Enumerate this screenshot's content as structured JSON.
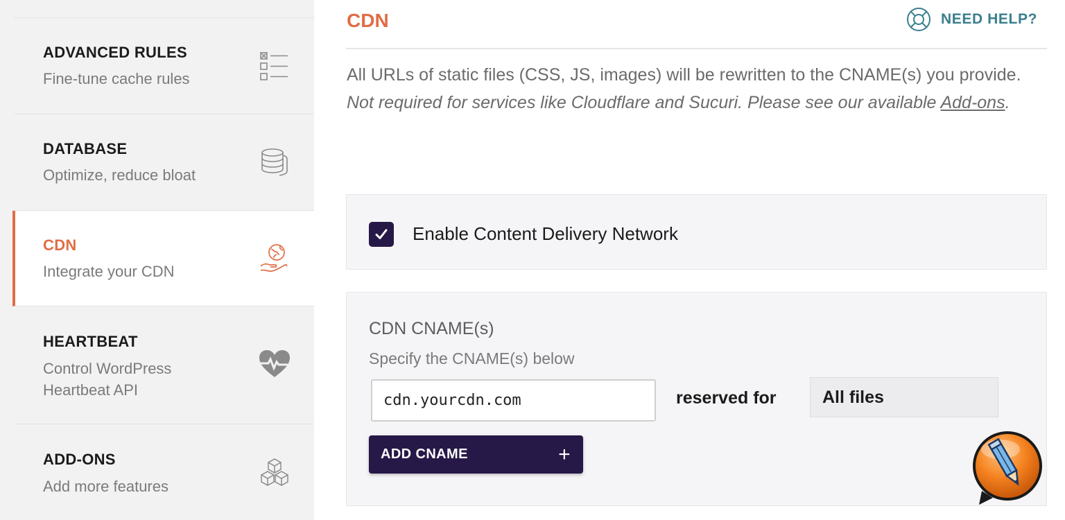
{
  "sidebar": {
    "items": [
      {
        "title": "ADVANCED RULES",
        "subtitle": "Fine-tune cache rules",
        "icon": "rules-list-icon"
      },
      {
        "title": "DATABASE",
        "subtitle": "Optimize, reduce bloat",
        "icon": "database-icon"
      },
      {
        "title": "CDN",
        "subtitle": "Integrate your CDN",
        "icon": "globe-hand-icon",
        "active": true
      },
      {
        "title": "HEARTBEAT",
        "subtitle_line1": "Control WordPress",
        "subtitle_line2": "Heartbeat API",
        "icon": "heartbeat-icon"
      },
      {
        "title": "ADD-ONS",
        "subtitle": "Add more features",
        "icon": "cubes-icon"
      }
    ]
  },
  "main": {
    "title": "CDN",
    "help_label": "NEED HELP?",
    "description": "All URLs of static files (CSS, JS, images) will be rewritten to the CNAME(s) you provide.",
    "note_prefix": "Not required for services like Cloudflare and Sucuri. Please see our available ",
    "note_link": "Add-ons",
    "note_suffix": ".",
    "enable_label": "Enable Content Delivery Network",
    "enable_checked": true,
    "cname": {
      "title": "CDN CNAME(s)",
      "subtitle": "Specify the CNAME(s) below",
      "value": "cdn.yourcdn.com",
      "reserved_label": "reserved for",
      "reserved_value": "All files",
      "add_button": "ADD CNAME",
      "add_icon": "+"
    }
  },
  "colors": {
    "accent": "#e06d45",
    "primary_dark": "#261847",
    "help_teal": "#3a7f8c",
    "sidebar_bg": "#f2f2f2"
  }
}
